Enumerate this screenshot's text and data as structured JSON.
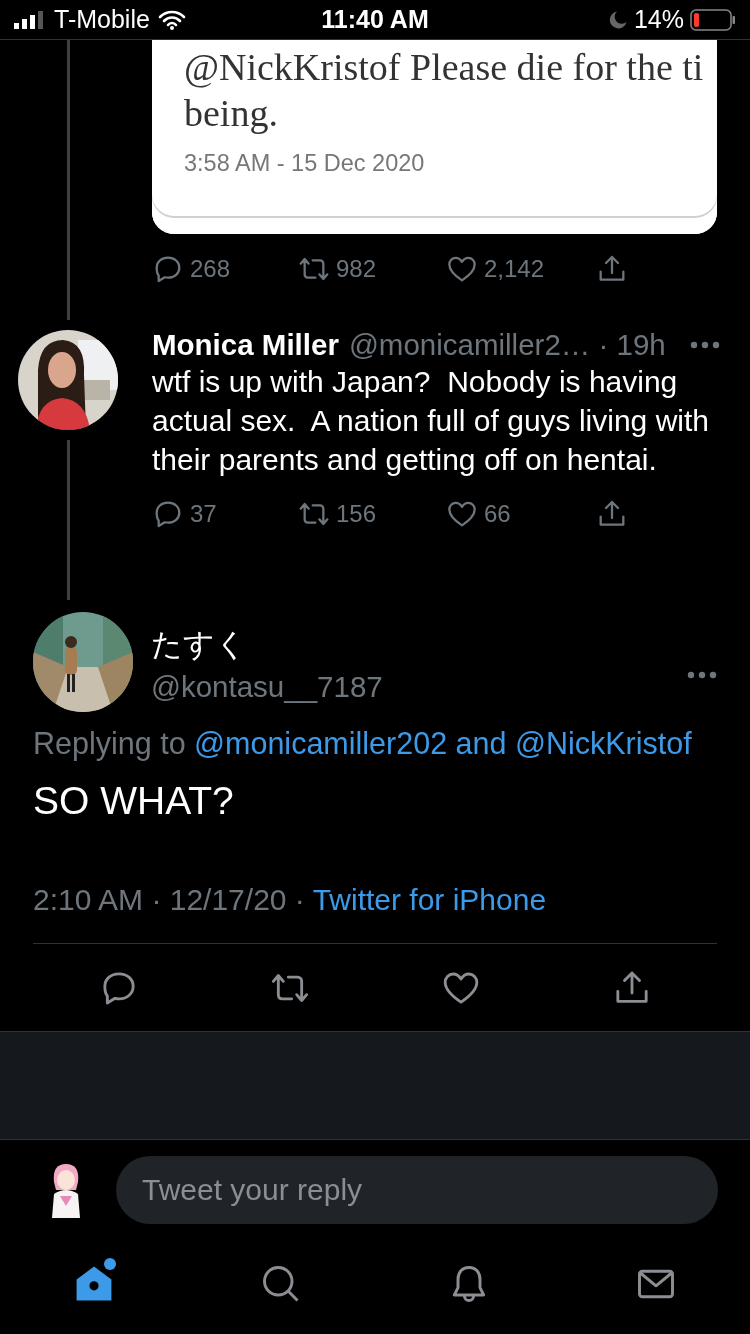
{
  "status_bar": {
    "carrier": "T-Mobile",
    "time": "11:40 AM",
    "battery": "14%"
  },
  "previous_tweet": {
    "embedded_card": {
      "text_lines": [
        "@NickKristof Please die for the ti",
        "being."
      ],
      "timestamp": "3:58 AM - 15 Dec 2020"
    },
    "metrics": [
      {
        "kind": "reply",
        "count": "268"
      },
      {
        "kind": "retweet",
        "count": "982"
      },
      {
        "kind": "like",
        "count": "2,142"
      },
      {
        "kind": "share"
      }
    ]
  },
  "parent_tweet": {
    "name": "Monica Miller",
    "handle_time": "@monicamiller2… · 19h",
    "text": "wtf is up with Japan?  Nobody is having actual sex.  A nation full of guys living with their parents and getting off on hentai.",
    "metrics": [
      {
        "kind": "reply",
        "count": "37"
      },
      {
        "kind": "retweet",
        "count": "156"
      },
      {
        "kind": "like",
        "count": "66"
      },
      {
        "kind": "share"
      }
    ]
  },
  "focused_tweet": {
    "name": "たすく",
    "handle": "@kontasu__7187",
    "replying_prefix": "Replying to",
    "replying_to": "@monicamiller202 and @NickKristof",
    "text": "SO WHAT?",
    "timestamp": "2:10 AM · 12/17/20 ·",
    "source": "Twitter for iPhone",
    "actions": [
      {
        "kind": "reply"
      },
      {
        "kind": "retweet"
      },
      {
        "kind": "like"
      },
      {
        "kind": "share"
      }
    ]
  },
  "reply_box": {
    "placeholder": "Tweet your reply"
  },
  "tab_bar": [
    {
      "kind": "home",
      "selected": true,
      "badge": true
    },
    {
      "kind": "search",
      "selected": false,
      "badge": false
    },
    {
      "kind": "notifications",
      "selected": false,
      "badge": false
    },
    {
      "kind": "messages",
      "selected": false,
      "badge": false
    }
  ]
}
